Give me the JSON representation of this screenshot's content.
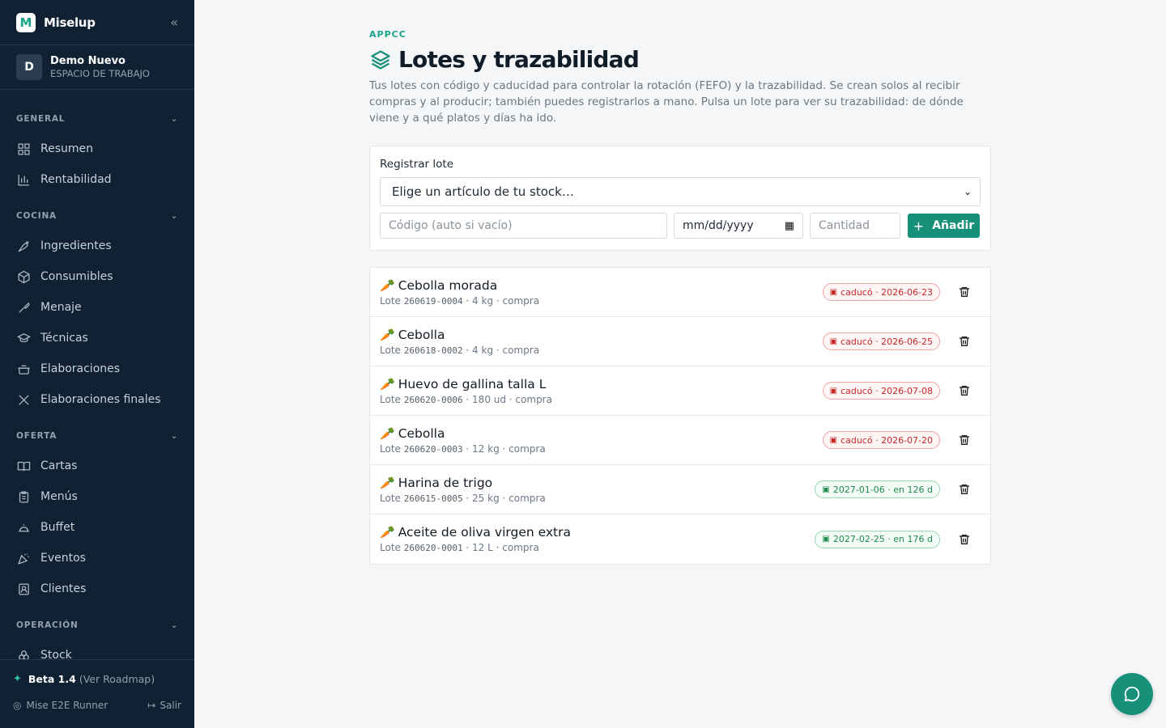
{
  "app": {
    "name": "Miselup",
    "logo_letter": "M"
  },
  "workspace": {
    "avatar": "D",
    "name": "Demo Nuevo",
    "subtitle": "ESPACIO DE TRABAJO"
  },
  "sidebar": {
    "sections": [
      {
        "title": "GENERAL",
        "items": [
          {
            "label": "Resumen",
            "icon": "grid-icon"
          },
          {
            "label": "Rentabilidad",
            "icon": "bar-chart-icon"
          }
        ]
      },
      {
        "title": "COCINA",
        "items": [
          {
            "label": "Ingredientes",
            "icon": "carrot-icon"
          },
          {
            "label": "Consumibles",
            "icon": "box-icon"
          },
          {
            "label": "Menaje",
            "icon": "utensil-icon"
          },
          {
            "label": "Técnicas",
            "icon": "cap-icon"
          },
          {
            "label": "Elaboraciones",
            "icon": "pot-icon"
          },
          {
            "label": "Elaboraciones finales",
            "icon": "cutlery-icon"
          }
        ]
      },
      {
        "title": "OFERTA",
        "items": [
          {
            "label": "Cartas",
            "icon": "book-icon"
          },
          {
            "label": "Menús",
            "icon": "clipboard-icon"
          },
          {
            "label": "Buffet",
            "icon": "cloche-icon"
          },
          {
            "label": "Eventos",
            "icon": "party-icon"
          },
          {
            "label": "Clientes",
            "icon": "contact-icon"
          }
        ]
      },
      {
        "title": "OPERACIÓN",
        "items": [
          {
            "label": "Stock",
            "icon": "boxes-icon"
          }
        ]
      }
    ],
    "footer": {
      "beta_label": "Beta 1.4",
      "roadmap_link": "(Ver Roadmap)",
      "user": "Mise E2E Runner",
      "logout": "Salir"
    }
  },
  "page": {
    "eyebrow": "APPCC",
    "title": "Lotes y trazabilidad",
    "description": "Tus lotes con código y caducidad para controlar la rotación (FEFO) y la trazabilidad. Se crean solos al recibir compras y al producir; también puedes registrarlos a mano. Pulsa un lote para ver su trazabilidad: de dónde viene y a qué platos y días ha ido."
  },
  "register": {
    "label": "Registrar lote",
    "article_select": "Elige un artículo de tu stock…",
    "code_placeholder": "Código (auto si vacío)",
    "date_placeholder": "mm/dd/yyyy",
    "qty_placeholder": "Cantidad",
    "add_button": "Añadir"
  },
  "lots": [
    {
      "emoji": "🥕",
      "name": "Cebolla morada",
      "lot_prefix": "Lote",
      "code": "260619-0004",
      "detail": "· 4 kg · compra",
      "badge": "caducó · 2026-06-23",
      "status": "expired"
    },
    {
      "emoji": "🥕",
      "name": "Cebolla",
      "lot_prefix": "Lote",
      "code": "260618-0002",
      "detail": "· 4 kg · compra",
      "badge": "caducó · 2026-06-25",
      "status": "expired"
    },
    {
      "emoji": "🥕",
      "name": "Huevo de gallina talla L",
      "lot_prefix": "Lote",
      "code": "260620-0006",
      "detail": "· 180 ud · compra",
      "badge": "caducó · 2026-07-08",
      "status": "expired"
    },
    {
      "emoji": "🥕",
      "name": "Cebolla",
      "lot_prefix": "Lote",
      "code": "260620-0003",
      "detail": "· 12 kg · compra",
      "badge": "caducó · 2026-07-20",
      "status": "expired"
    },
    {
      "emoji": "🥕",
      "name": "Harina de trigo",
      "lot_prefix": "Lote",
      "code": "260615-0005",
      "detail": "· 25 kg · compra",
      "badge": "2027-01-06 · en 126 d",
      "status": "ok"
    },
    {
      "emoji": "🥕",
      "name": "Aceite de oliva virgen extra",
      "lot_prefix": "Lote",
      "code": "260620-0001",
      "detail": "· 12 L · compra",
      "badge": "2027-02-25 · en 176 d",
      "status": "ok"
    }
  ],
  "colors": {
    "sidebar_bg": "#0f2132",
    "accent": "#17907a",
    "expired": "#c62828",
    "ok": "#1f8a4c"
  }
}
